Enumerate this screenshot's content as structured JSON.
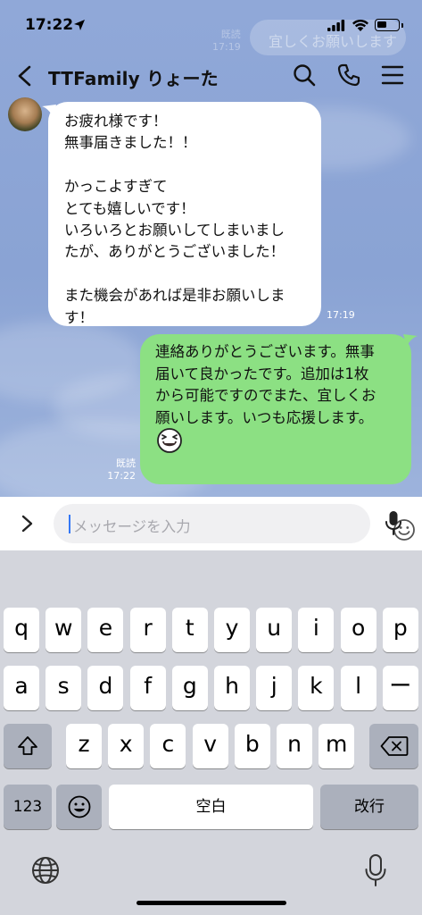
{
  "status_bar": {
    "time": "17:22"
  },
  "background_chat": {
    "ghost_text": "宜しくお願いします",
    "ghost_meta": "既読\n17:19"
  },
  "header": {
    "title": "TTFamily りょーた"
  },
  "messages": {
    "incoming": {
      "text": "お疲れ様です！\n無事届きました！！\n\nかっこよすぎて\nとても嬉しいです！\nいろいろとお願いしてしまいまし\nたが、ありがとうございました！\n\nまた機会があれば是非お願いしま\nす！",
      "time": "17:19"
    },
    "outgoing": {
      "text": "連絡ありがとうございます。無事\n届いて良かったです。追加は1枚\nから可能ですのでまた、宜しくお\n願いします。いつも応援します。",
      "emoji": "laughing-emoji",
      "read_label": "既読",
      "time": "17:22"
    }
  },
  "input": {
    "placeholder": "メッセージを入力"
  },
  "keyboard": {
    "row1": [
      "q",
      "w",
      "e",
      "r",
      "t",
      "y",
      "u",
      "i",
      "o",
      "p"
    ],
    "row2": [
      "a",
      "s",
      "d",
      "f",
      "g",
      "h",
      "j",
      "k",
      "l",
      "ー"
    ],
    "row3": [
      "z",
      "x",
      "c",
      "v",
      "b",
      "n",
      "m"
    ],
    "num_key": "123",
    "space_key": "空白",
    "return_key": "改行"
  },
  "colors": {
    "chat_background": "#8ea7d6",
    "outgoing_bubble": "#8ce083",
    "incoming_bubble": "#ffffff",
    "keyboard_background": "#d3d5dc"
  }
}
